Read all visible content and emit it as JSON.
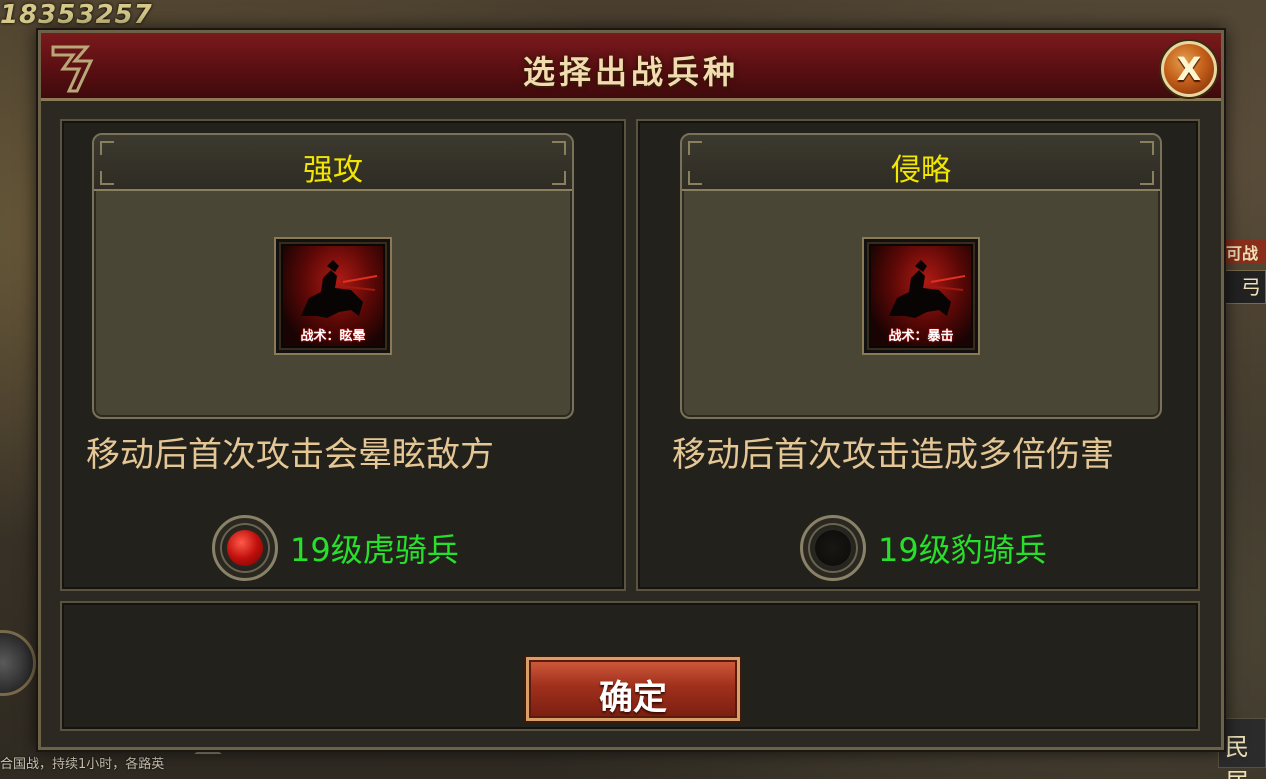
{
  "background": {
    "top_number": "18353257",
    "right_tag_top": "可战",
    "right_tag_mid": "弓",
    "right_tag_bottom": "民居",
    "bottom_ticker": "合国战，持续1小时，各路英"
  },
  "dialog": {
    "title": "选择出战兵种",
    "close_icon": "X",
    "options": [
      {
        "name": "强攻",
        "skill_label": "战术：眩晕",
        "description": "移动后首次攻击会晕眩敌方",
        "unit": "19级虎骑兵",
        "selected": true
      },
      {
        "name": "侵略",
        "skill_label": "战术：暴击",
        "description": "移动后首次攻击造成多倍伤害",
        "unit": "19级豹骑兵",
        "selected": false
      }
    ],
    "confirm_label": "确定"
  },
  "colors": {
    "title_bar": "#5a0f12",
    "option_title": "#f2e600",
    "description": "#e5c795",
    "unit_label": "#27e02b",
    "radio_selected": "#c0100c",
    "confirm_button": "#a0301c"
  }
}
